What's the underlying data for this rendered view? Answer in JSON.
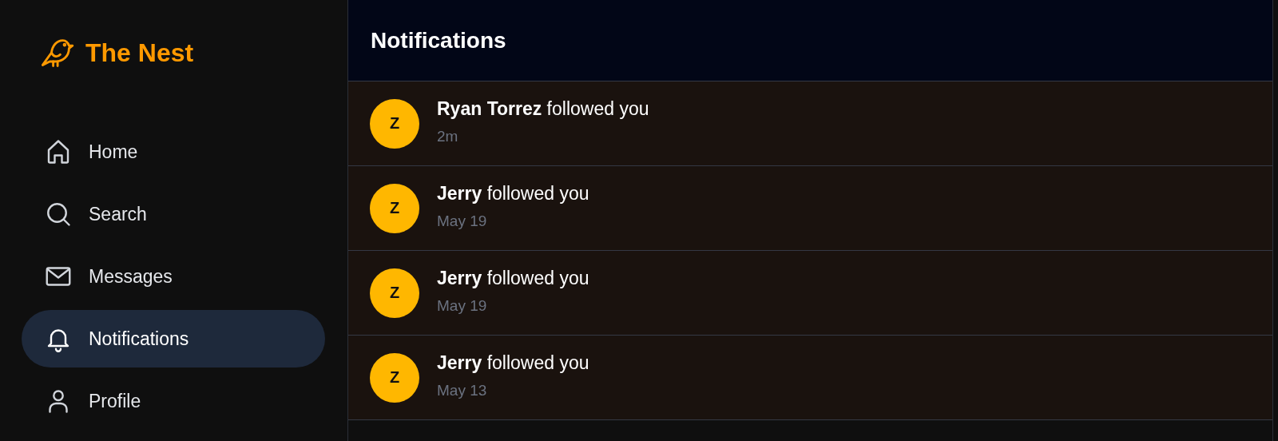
{
  "brand": {
    "name": "The Nest"
  },
  "sidebar": {
    "items": [
      {
        "label": "Home",
        "selected": false
      },
      {
        "label": "Search",
        "selected": false
      },
      {
        "label": "Messages",
        "selected": false
      },
      {
        "label": "Notifications",
        "selected": true
      },
      {
        "label": "Profile",
        "selected": false
      }
    ]
  },
  "header": {
    "title": "Notifications"
  },
  "notifications": [
    {
      "avatar": "Z",
      "text": "**Ryan Torrez** followed you",
      "time": "2m"
    },
    {
      "avatar": "Z",
      "text": "**Jerry** followed you",
      "time": "May 19"
    },
    {
      "avatar": "Z",
      "text": "**Jerry** followed you",
      "time": "May 19"
    },
    {
      "avatar": "Z",
      "text": "**Jerry** followed you",
      "time": "May 13"
    }
  ]
}
